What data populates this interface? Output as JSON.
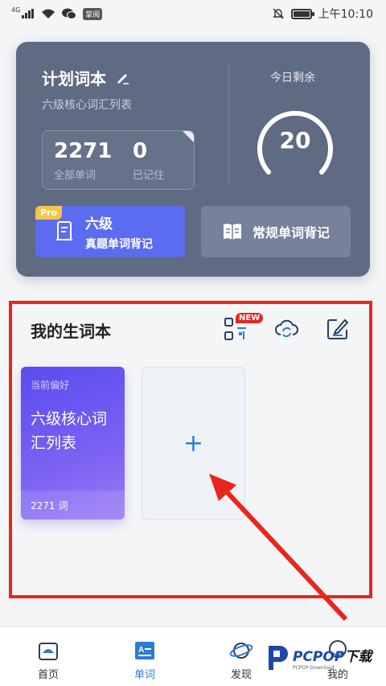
{
  "status_bar": {
    "network": "4G",
    "app_badge": "掌阅",
    "time": "上午10:10"
  },
  "plan_card": {
    "title": "计划词本",
    "subtitle": "六级核心词汇列表",
    "total_words": "2271",
    "total_label": "全部单词",
    "remembered_words": "0",
    "remembered_label": "已记住",
    "remaining_label": "今日剩余",
    "remaining_count": "20",
    "cet6_button": {
      "badge": "Pro",
      "line1": "六级",
      "line2": "真题单词背记"
    },
    "normal_button_label": "常规单词背记"
  },
  "vocab_section": {
    "title": "我的生词本",
    "new_badge": "NEW",
    "book": {
      "tag": "当前偏好",
      "name": "六级核心词汇列表",
      "count": "2271 词"
    },
    "add_symbol": "+"
  },
  "bottom_nav": {
    "items": [
      {
        "label": "首页"
      },
      {
        "label": "单词"
      },
      {
        "label": "发现"
      },
      {
        "label": "我的"
      }
    ],
    "active_index": 1
  },
  "watermark": {
    "brand": "PCPOP",
    "brand_suffix": "下载",
    "tagline": "PCPOP Download"
  },
  "colors": {
    "card_bg": "#5f6b82",
    "cet6_button": "#5b6cf0",
    "accent_blue": "#2c7cd6",
    "annotation_red": "#e8261c",
    "book_card": "#6a56f1"
  }
}
